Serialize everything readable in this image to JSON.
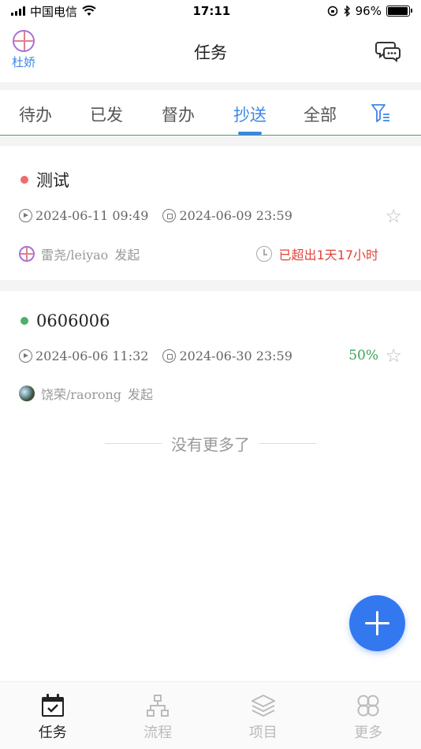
{
  "status_bar": {
    "carrier": "中国电信",
    "time": "17:11",
    "battery": "96%"
  },
  "header": {
    "user_name": "杜娇",
    "title": "任务"
  },
  "tabs": [
    {
      "label": "待办"
    },
    {
      "label": "已发"
    },
    {
      "label": "督办"
    },
    {
      "label": "抄送",
      "active": true
    },
    {
      "label": "全部"
    }
  ],
  "tasks": [
    {
      "title": "测试",
      "dot_color": "#ef6b6b",
      "start": "2024-06-11 09:49",
      "end": "2024-06-09 23:59",
      "initiator": "雷尧/leiyao",
      "action": "发起",
      "overdue_text": "已超出1天17小时"
    },
    {
      "title": "0606006",
      "dot_color": "#4caf6a",
      "start": "2024-06-06 11:32",
      "end": "2024-06-30 23:59",
      "progress": "50%",
      "initiator": "饶荣/raorong",
      "action": "发起"
    }
  ],
  "list_end_text": "没有更多了",
  "bottom_nav": [
    {
      "label": "任务",
      "active": true
    },
    {
      "label": "流程"
    },
    {
      "label": "项目"
    },
    {
      "label": "更多"
    }
  ],
  "colors": {
    "accent": "#3a86e6",
    "fab": "#3478f0",
    "success": "#3aa35a",
    "danger": "#e0443c"
  }
}
